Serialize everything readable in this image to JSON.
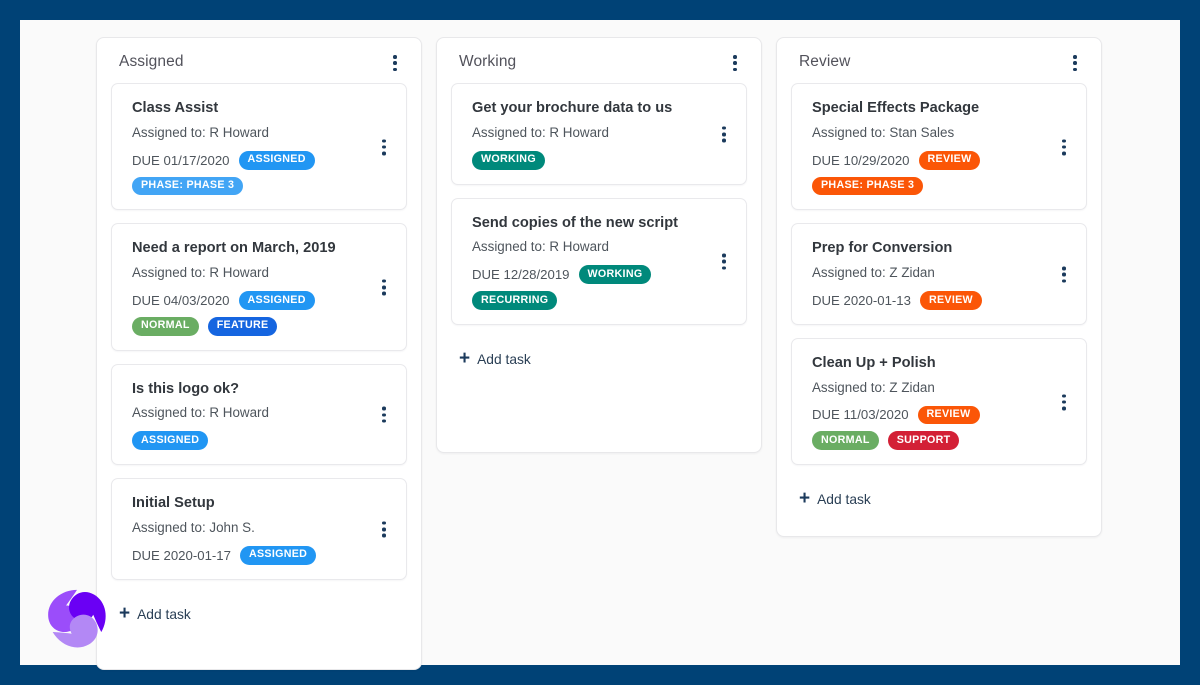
{
  "theme": {
    "frame_color": "#004276",
    "canvas_color": "#fafafa",
    "card_color": "#ffffff"
  },
  "logo": {
    "name": "pinwheel-logo",
    "colors": [
      "#9b4dfa",
      "#6a00f4",
      "#b388f5"
    ]
  },
  "add_task_label": "Add task",
  "columns": [
    {
      "title": "Assigned",
      "cards": [
        {
          "title": "Class Assist",
          "assignee": "Assigned to: R Howard",
          "due": "DUE 01/17/2020",
          "tags": [
            {
              "label": "ASSIGNED",
              "color": "t-assigned"
            },
            {
              "label": "PHASE: PHASE 3",
              "color": "t-phase"
            }
          ]
        },
        {
          "title": "Need a report on March, 2019",
          "assignee": "Assigned to: R Howard",
          "due": "DUE 04/03/2020",
          "tags": [
            {
              "label": "ASSIGNED",
              "color": "t-assigned"
            },
            {
              "label": "NORMAL",
              "color": "t-normal"
            },
            {
              "label": "FEATURE",
              "color": "t-feature"
            }
          ]
        },
        {
          "title": "Is this logo ok?",
          "assignee": "Assigned to: R Howard",
          "due": "",
          "tags": [
            {
              "label": "ASSIGNED",
              "color": "t-assigned"
            }
          ]
        },
        {
          "title": "Initial Setup",
          "assignee": "Assigned to: John S.",
          "due": "DUE 2020-01-17",
          "tags": [
            {
              "label": "ASSIGNED",
              "color": "t-assigned"
            }
          ]
        }
      ]
    },
    {
      "title": "Working",
      "cards": [
        {
          "title": "Get your brochure data to us",
          "assignee": "Assigned to: R Howard",
          "due": "",
          "tags": [
            {
              "label": "WORKING",
              "color": "t-working"
            }
          ]
        },
        {
          "title": "Send copies of the new script",
          "assignee": "Assigned to: R Howard",
          "due": "DUE 12/28/2019",
          "tags": [
            {
              "label": "WORKING",
              "color": "t-working"
            },
            {
              "label": "RECURRING",
              "color": "t-recurring"
            }
          ]
        }
      ]
    },
    {
      "title": "Review",
      "cards": [
        {
          "title": "Special Effects Package",
          "assignee": "Assigned to: Stan Sales",
          "due": "DUE 10/29/2020",
          "tags": [
            {
              "label": "REVIEW",
              "color": "t-review"
            },
            {
              "label": "PHASE: PHASE 3",
              "color": "t-review"
            }
          ]
        },
        {
          "title": "Prep for Conversion",
          "assignee": "Assigned to: Z Zidan",
          "due": "DUE 2020-01-13",
          "tags": [
            {
              "label": "REVIEW",
              "color": "t-review"
            }
          ]
        },
        {
          "title": "Clean Up + Polish",
          "assignee": "Assigned to: Z Zidan",
          "due": "DUE 11/03/2020",
          "tags": [
            {
              "label": "REVIEW",
              "color": "t-review"
            },
            {
              "label": "NORMAL",
              "color": "t-normal"
            },
            {
              "label": "SUPPORT",
              "color": "t-support"
            }
          ]
        }
      ]
    }
  ]
}
